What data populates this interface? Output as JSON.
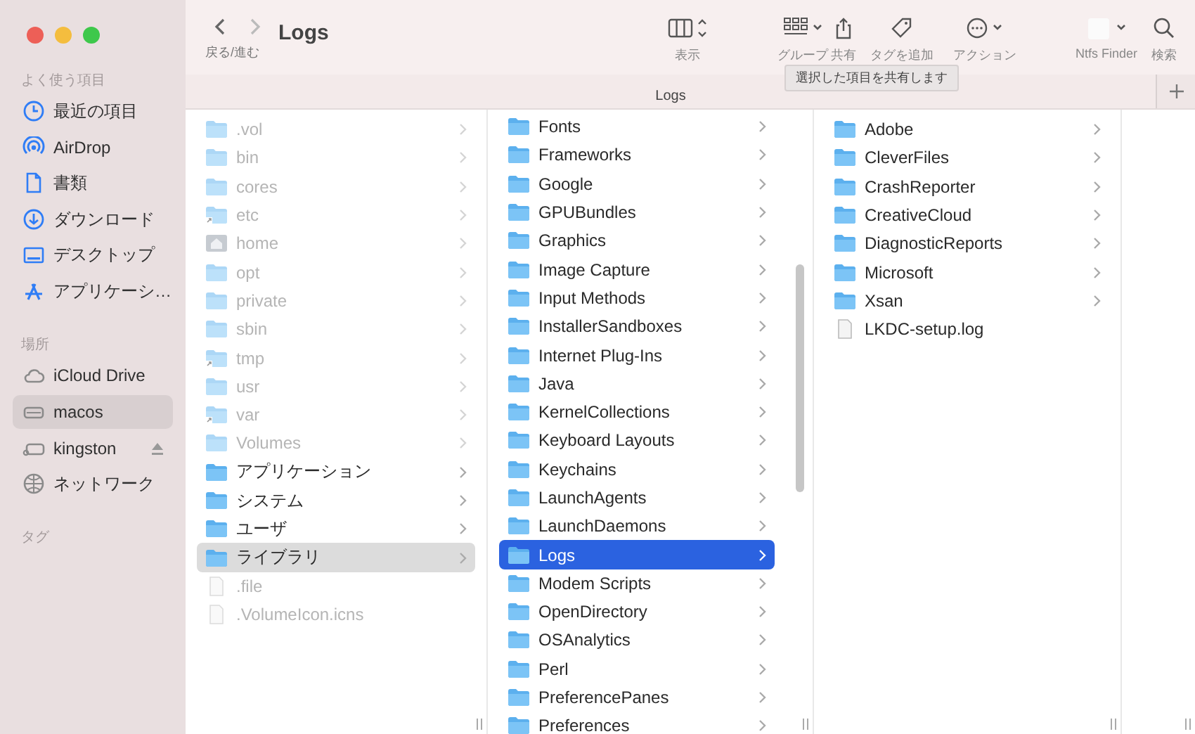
{
  "window": {
    "title": "Logs",
    "nav_label": "戻る/進む"
  },
  "sidebar": {
    "sections": [
      {
        "header": "よく使う項目",
        "items": [
          {
            "label": "最近の項目",
            "kind": "recents",
            "selected": false
          },
          {
            "label": "AirDrop",
            "kind": "airdrop",
            "selected": false
          },
          {
            "label": "書類",
            "kind": "documents",
            "selected": false
          },
          {
            "label": "ダウンロード",
            "kind": "downloads",
            "selected": false
          },
          {
            "label": "デスクトップ",
            "kind": "desktop",
            "selected": false
          },
          {
            "label": "アプリケーシ…",
            "kind": "applications",
            "selected": false
          }
        ]
      },
      {
        "header": "場所",
        "items": [
          {
            "label": "iCloud Drive",
            "kind": "cloud",
            "selected": false
          },
          {
            "label": "macos",
            "kind": "disk",
            "selected": true
          },
          {
            "label": "kingston",
            "kind": "external",
            "selected": false,
            "eject": true
          },
          {
            "label": "ネットワーク",
            "kind": "network",
            "selected": false
          }
        ]
      },
      {
        "header": "タグ"
      }
    ]
  },
  "toolbar": {
    "buttons": [
      {
        "kind": "view",
        "label": "表示"
      },
      {
        "kind": "group",
        "label": "グループ"
      },
      {
        "kind": "share",
        "label": "共有"
      },
      {
        "kind": "tag",
        "label": "タグを追加"
      },
      {
        "kind": "action",
        "label": "アクション"
      },
      {
        "kind": "extension",
        "label": "Ntfs Finder"
      },
      {
        "kind": "search",
        "label": "検索"
      }
    ],
    "tooltip": "選択した項目を共有します"
  },
  "tab": {
    "label": "Logs"
  },
  "columns": [
    {
      "focused": false,
      "items": [
        {
          "name": ".vol",
          "kind": "folder",
          "hidden": true,
          "selected": false
        },
        {
          "name": "bin",
          "kind": "folder",
          "hidden": true,
          "selected": false
        },
        {
          "name": "cores",
          "kind": "folder",
          "hidden": true,
          "selected": false
        },
        {
          "name": "etc",
          "kind": "alias",
          "hidden": true,
          "selected": false
        },
        {
          "name": "home",
          "kind": "home",
          "hidden": true,
          "selected": false
        },
        {
          "name": "opt",
          "kind": "folder",
          "hidden": true,
          "selected": false
        },
        {
          "name": "private",
          "kind": "folder",
          "hidden": true,
          "selected": false
        },
        {
          "name": "sbin",
          "kind": "folder",
          "hidden": true,
          "selected": false
        },
        {
          "name": "tmp",
          "kind": "alias",
          "hidden": true,
          "selected": false
        },
        {
          "name": "usr",
          "kind": "folder",
          "hidden": true,
          "selected": false
        },
        {
          "name": "var",
          "kind": "alias",
          "hidden": true,
          "selected": false
        },
        {
          "name": "Volumes",
          "kind": "folder",
          "hidden": true,
          "selected": false
        },
        {
          "name": "アプリケーション",
          "kind": "folder",
          "hidden": false,
          "selected": false
        },
        {
          "name": "システム",
          "kind": "folder",
          "hidden": false,
          "selected": false
        },
        {
          "name": "ユーザ",
          "kind": "folder",
          "hidden": false,
          "selected": false
        },
        {
          "name": "ライブラリ",
          "kind": "folder",
          "hidden": false,
          "selected": true
        },
        {
          "name": ".file",
          "kind": "file",
          "hidden": true,
          "selected": false
        },
        {
          "name": ".VolumeIcon.icns",
          "kind": "file",
          "hidden": true,
          "selected": false
        }
      ]
    },
    {
      "focused": true,
      "items": [
        {
          "name": "Fonts",
          "kind": "folder",
          "hidden": false,
          "selected": false
        },
        {
          "name": "Frameworks",
          "kind": "folder",
          "hidden": false,
          "selected": false
        },
        {
          "name": "Google",
          "kind": "folder",
          "hidden": false,
          "selected": false
        },
        {
          "name": "GPUBundles",
          "kind": "folder",
          "hidden": false,
          "selected": false
        },
        {
          "name": "Graphics",
          "kind": "folder",
          "hidden": false,
          "selected": false
        },
        {
          "name": "Image Capture",
          "kind": "folder",
          "hidden": false,
          "selected": false
        },
        {
          "name": "Input Methods",
          "kind": "folder",
          "hidden": false,
          "selected": false
        },
        {
          "name": "InstallerSandboxes",
          "kind": "folder",
          "hidden": false,
          "selected": false
        },
        {
          "name": "Internet Plug-Ins",
          "kind": "folder",
          "hidden": false,
          "selected": false
        },
        {
          "name": "Java",
          "kind": "folder",
          "hidden": false,
          "selected": false
        },
        {
          "name": "KernelCollections",
          "kind": "folder",
          "hidden": false,
          "selected": false
        },
        {
          "name": "Keyboard Layouts",
          "kind": "folder",
          "hidden": false,
          "selected": false
        },
        {
          "name": "Keychains",
          "kind": "folder",
          "hidden": false,
          "selected": false
        },
        {
          "name": "LaunchAgents",
          "kind": "folder",
          "hidden": false,
          "selected": false
        },
        {
          "name": "LaunchDaemons",
          "kind": "folder",
          "hidden": false,
          "selected": false
        },
        {
          "name": "Logs",
          "kind": "folder",
          "hidden": false,
          "selected": true
        },
        {
          "name": "Modem Scripts",
          "kind": "folder",
          "hidden": false,
          "selected": false
        },
        {
          "name": "OpenDirectory",
          "kind": "folder",
          "hidden": false,
          "selected": false
        },
        {
          "name": "OSAnalytics",
          "kind": "folder",
          "hidden": false,
          "selected": false
        },
        {
          "name": "Perl",
          "kind": "folder",
          "hidden": false,
          "selected": false
        },
        {
          "name": "PreferencePanes",
          "kind": "folder",
          "hidden": false,
          "selected": false
        },
        {
          "name": "Preferences",
          "kind": "folder",
          "hidden": false,
          "selected": false
        }
      ]
    },
    {
      "items": [
        {
          "name": "Adobe",
          "kind": "folder",
          "hidden": false,
          "selected": false
        },
        {
          "name": "CleverFiles",
          "kind": "folder",
          "hidden": false,
          "selected": false
        },
        {
          "name": "CrashReporter",
          "kind": "folder",
          "hidden": false,
          "selected": false
        },
        {
          "name": "CreativeCloud",
          "kind": "folder",
          "hidden": false,
          "selected": false
        },
        {
          "name": "DiagnosticReports",
          "kind": "folder",
          "hidden": false,
          "selected": false
        },
        {
          "name": "Microsoft",
          "kind": "folder",
          "hidden": false,
          "selected": false
        },
        {
          "name": "Xsan",
          "kind": "folder",
          "hidden": false,
          "selected": false
        },
        {
          "name": "LKDC-setup.log",
          "kind": "file",
          "hidden": false,
          "selected": false
        }
      ]
    }
  ]
}
